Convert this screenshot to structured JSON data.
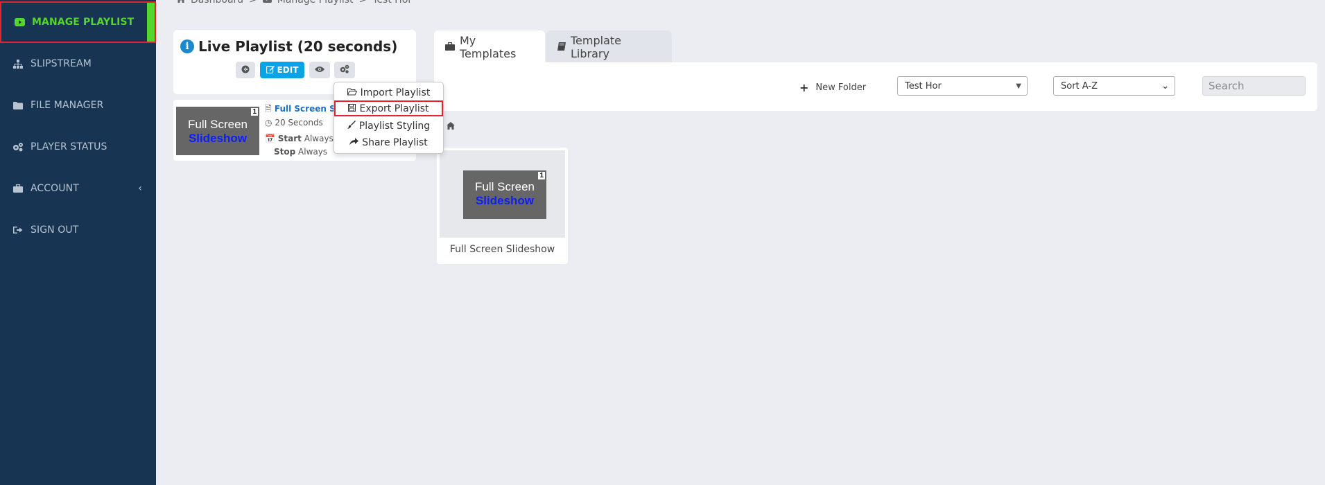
{
  "sidebar": {
    "items": [
      {
        "label": "MANAGE PLAYLIST",
        "icon": "play-icon"
      },
      {
        "label": "SLIPSTREAM",
        "icon": "sitemap-icon"
      },
      {
        "label": "FILE MANAGER",
        "icon": "folder-icon"
      },
      {
        "label": "PLAYER STATUS",
        "icon": "gears-icon"
      },
      {
        "label": "ACCOUNT",
        "icon": "briefcase-icon"
      },
      {
        "label": "SIGN OUT",
        "icon": "sign-out-icon"
      }
    ]
  },
  "breadcrumb": {
    "items": [
      "Dashboard",
      "Manage Playlist",
      "Test Hor"
    ],
    "separator": ">"
  },
  "live": {
    "title": "Live Playlist (20 seconds)",
    "edit_label": "EDIT"
  },
  "menu": {
    "items": [
      "Import Playlist",
      "Export Playlist",
      "Playlist Styling",
      "Share Playlist"
    ]
  },
  "playlist_item": {
    "thumb_line1": "Full Screen",
    "thumb_line2": "Slideshow",
    "number": "1",
    "name": "Full Screen Slic",
    "duration": "20 Seconds",
    "start_label": "Start",
    "start_value": "Always",
    "stop_label": "Stop",
    "stop_value": "Always"
  },
  "tabs": [
    {
      "label": "My Templates"
    },
    {
      "label": "Template Library"
    }
  ],
  "toolbar": {
    "new_folder": "New Folder",
    "folder_select": "Test Hor",
    "sort_select": "Sort A-Z",
    "search_placeholder": "Search"
  },
  "template": {
    "thumb_line1": "Full Screen",
    "thumb_line2": "Slideshow",
    "number": "1",
    "caption": "Full Screen Slideshow"
  },
  "colors": {
    "sidebar_bg": "#173553",
    "active_green": "#54d62c",
    "highlight_red": "#e3232e",
    "edit_blue": "#0aa3e6",
    "link_blue": "#1a73c8"
  }
}
